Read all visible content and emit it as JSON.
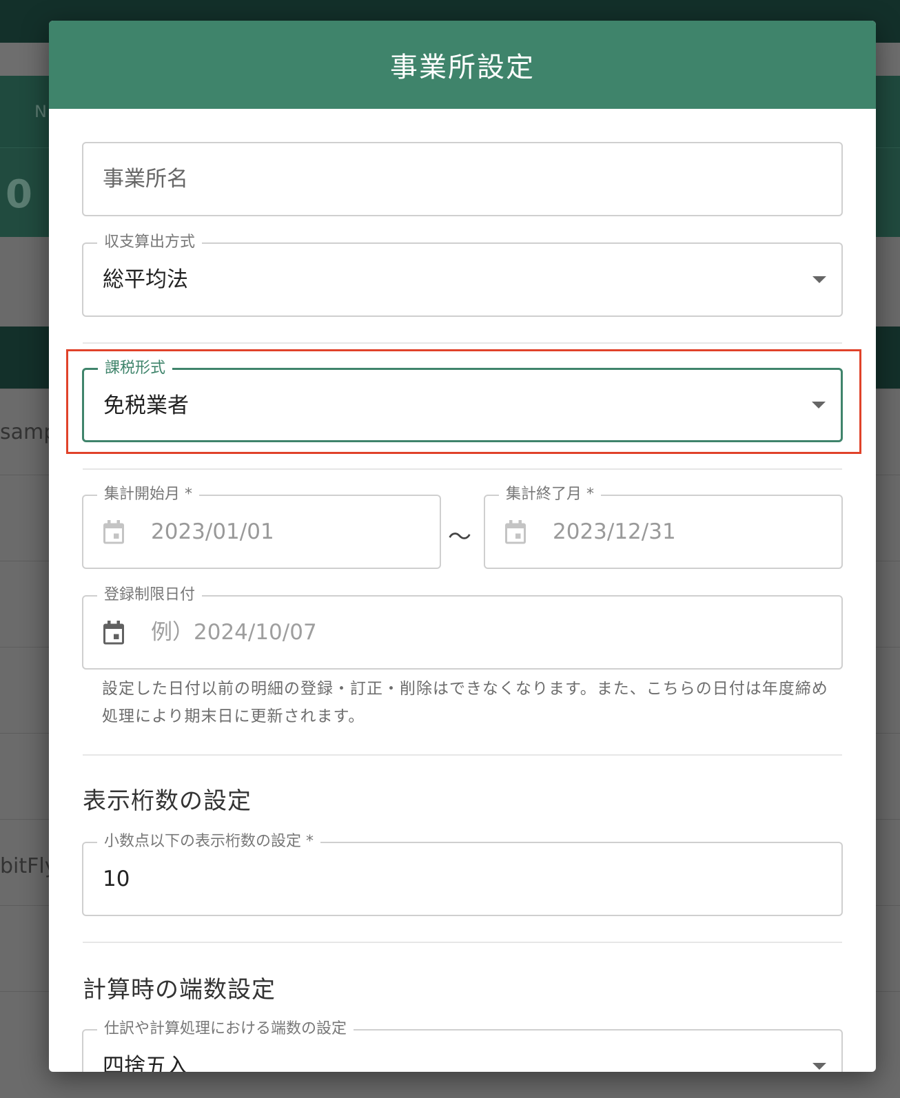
{
  "background": {
    "col_fragment": "N",
    "big_number": "0",
    "row1_text": "samp",
    "row2_text": "bitFly"
  },
  "dialog": {
    "title": "事業所設定",
    "office_name": {
      "placeholder": "事業所名"
    },
    "income_method": {
      "label": "収支算出方式",
      "value": "総平均法"
    },
    "tax_type": {
      "label": "課税形式",
      "value": "免税業者"
    },
    "period_start": {
      "label": "集計開始月 *",
      "value": "2023/01/01"
    },
    "period_separator": "〜",
    "period_end": {
      "label": "集計終了月 *",
      "value": "2023/12/31"
    },
    "registration_limit": {
      "label": "登録制限日付",
      "placeholder": "例）2024/10/07",
      "helper": "設定した日付以前の明細の登録・訂正・削除はできなくなります。また、こちらの日付は年度締め処理により期末日に更新されます。"
    },
    "digits_section": {
      "title": "表示桁数の設定",
      "decimal_label": "小数点以下の表示桁数の設定 *",
      "decimal_value": "10"
    },
    "rounding_section": {
      "title": "計算時の端数設定",
      "rounding_label": "仕訳や計算処理における端数の設定",
      "rounding_value": "四捨五入"
    }
  },
  "colors": {
    "header": "#3f846b",
    "focus": "#3f846b",
    "highlight": "#e0422a"
  }
}
